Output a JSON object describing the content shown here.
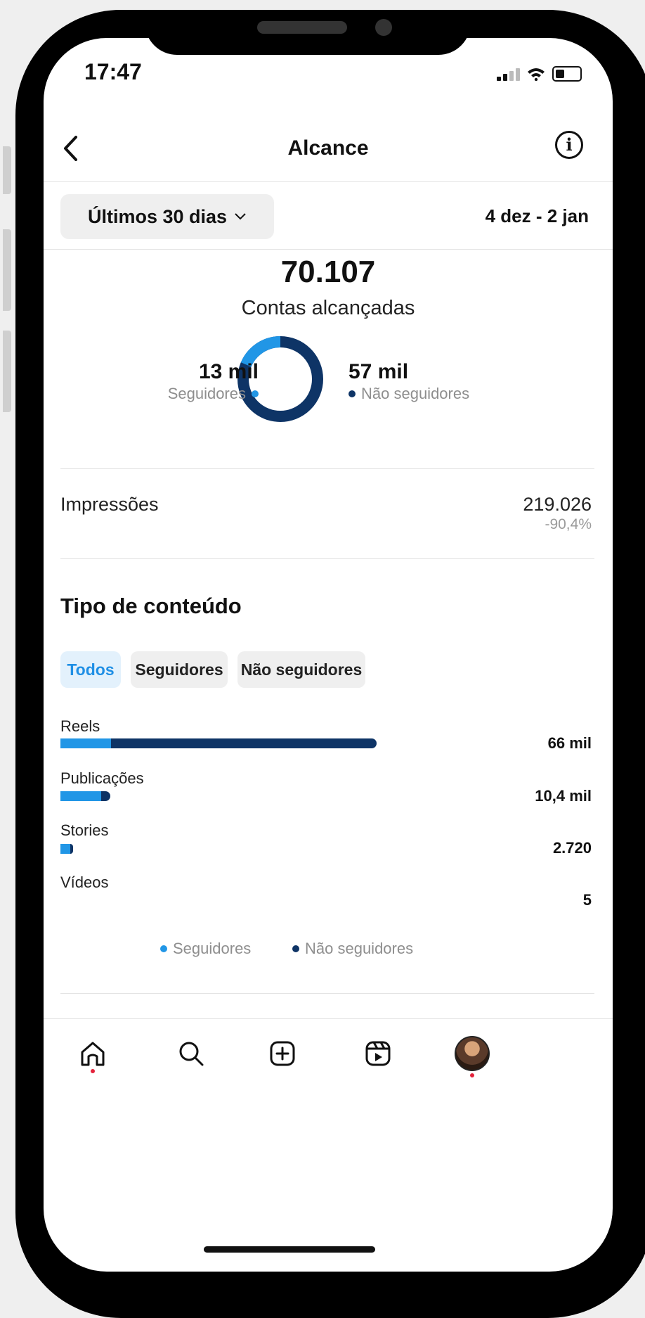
{
  "status_bar": {
    "time": "17:47"
  },
  "header": {
    "title": "Alcance",
    "back_icon": "chevron-left-icon",
    "info_icon": "info-icon"
  },
  "period": {
    "selected": "Últimos 30 dias",
    "range": "4 dez - 2 jan"
  },
  "summary": {
    "accounts_reached": "70.107",
    "accounts_label": "Contas alcançadas",
    "followers_value": "13 mil",
    "followers_label": "Seguidores",
    "non_followers_value": "57 mil",
    "non_followers_label": "Não seguidores",
    "followers_fraction": 0.186
  },
  "impressions": {
    "label": "Impressões",
    "value": "219.026",
    "change": "-90,4%"
  },
  "content_type": {
    "title": "Tipo de conteúdo",
    "filters": [
      "Todos",
      "Seguidores",
      "Não seguidores"
    ],
    "active_filter": "Todos",
    "rows": [
      {
        "label": "Reels",
        "value": "66 mil",
        "followers_share": 0.16,
        "total_share": 1.0
      },
      {
        "label": "Publicações",
        "value": "10,4 mil",
        "followers_share": 0.82,
        "total_share": 0.158
      },
      {
        "label": "Stories",
        "value": "2.720",
        "followers_share": 0.8,
        "total_share": 0.041
      },
      {
        "label": "Vídeos",
        "value": "5",
        "followers_share": 0,
        "total_share": 0
      }
    ],
    "legend": [
      "Seguidores",
      "Não seguidores"
    ]
  },
  "colors": {
    "followers": "#2196e6",
    "non_followers": "#0e3466",
    "notification_dot": "#e4233c"
  },
  "tab_bar": [
    "home-icon",
    "search-icon",
    "create-icon",
    "reels-icon",
    "profile-avatar"
  ]
}
